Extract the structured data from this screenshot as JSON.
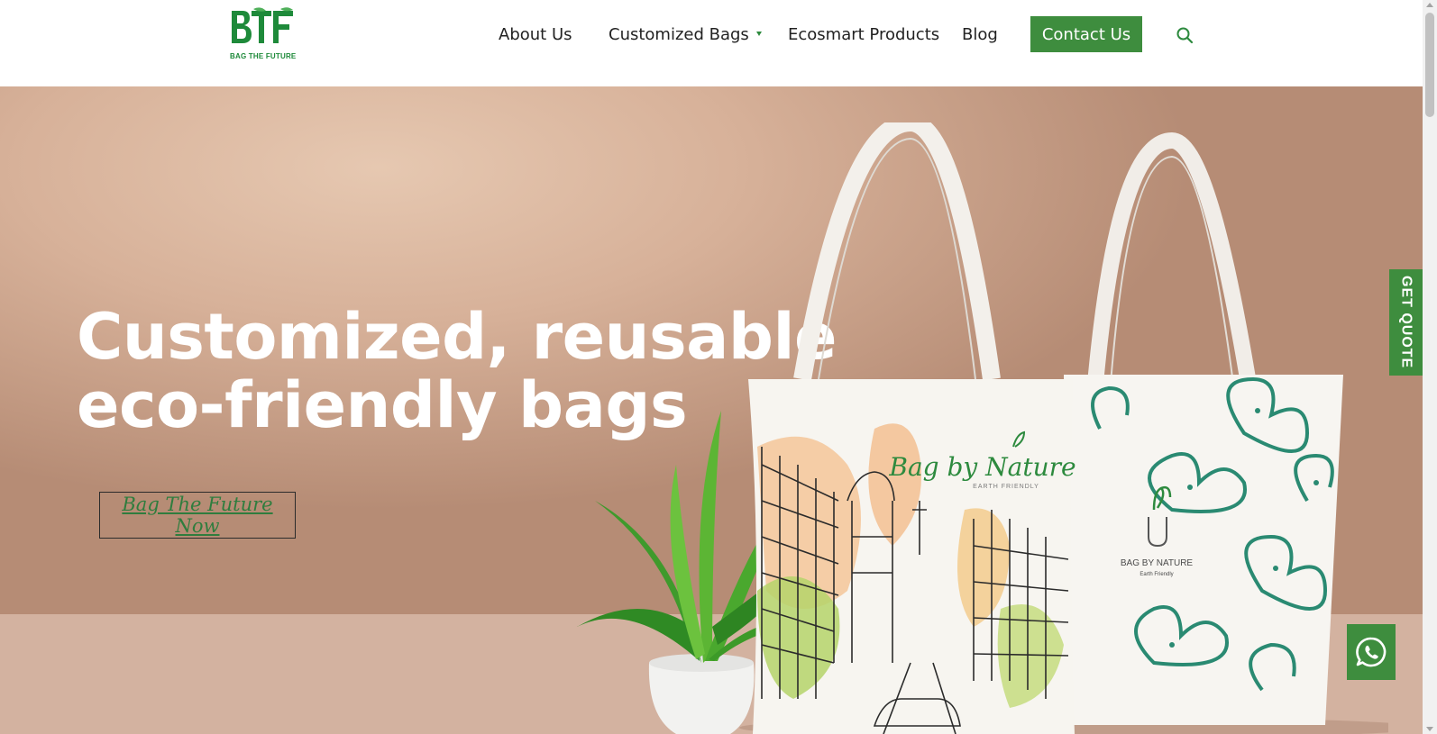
{
  "brand": {
    "logo_mark": "BTF",
    "logo_tagline": "BAG THE FUTURE",
    "accent_color": "#3e8d3e",
    "logo_color": "#1e8a3a"
  },
  "nav": {
    "items": [
      {
        "label": "About Us"
      },
      {
        "label": "Customized Bags",
        "has_dropdown": true
      },
      {
        "label": "Ecosmart Products"
      },
      {
        "label": "Blog"
      }
    ],
    "contact_label": "Contact Us",
    "search_icon": "search-icon"
  },
  "hero": {
    "title_line1": "Customized, reusable",
    "title_line2": "eco-friendly  bags",
    "cta_label": "Bag The Future Now",
    "bag_left_print": "Bag by Nature",
    "bag_left_sub": "EARTH FRIENDLY",
    "bag_right_print": "BAG BY NATURE",
    "bag_right_sub": "Earth Friendly"
  },
  "widgets": {
    "get_quote_label": "GET QUOTE",
    "whatsapp_icon": "whatsapp-icon"
  }
}
